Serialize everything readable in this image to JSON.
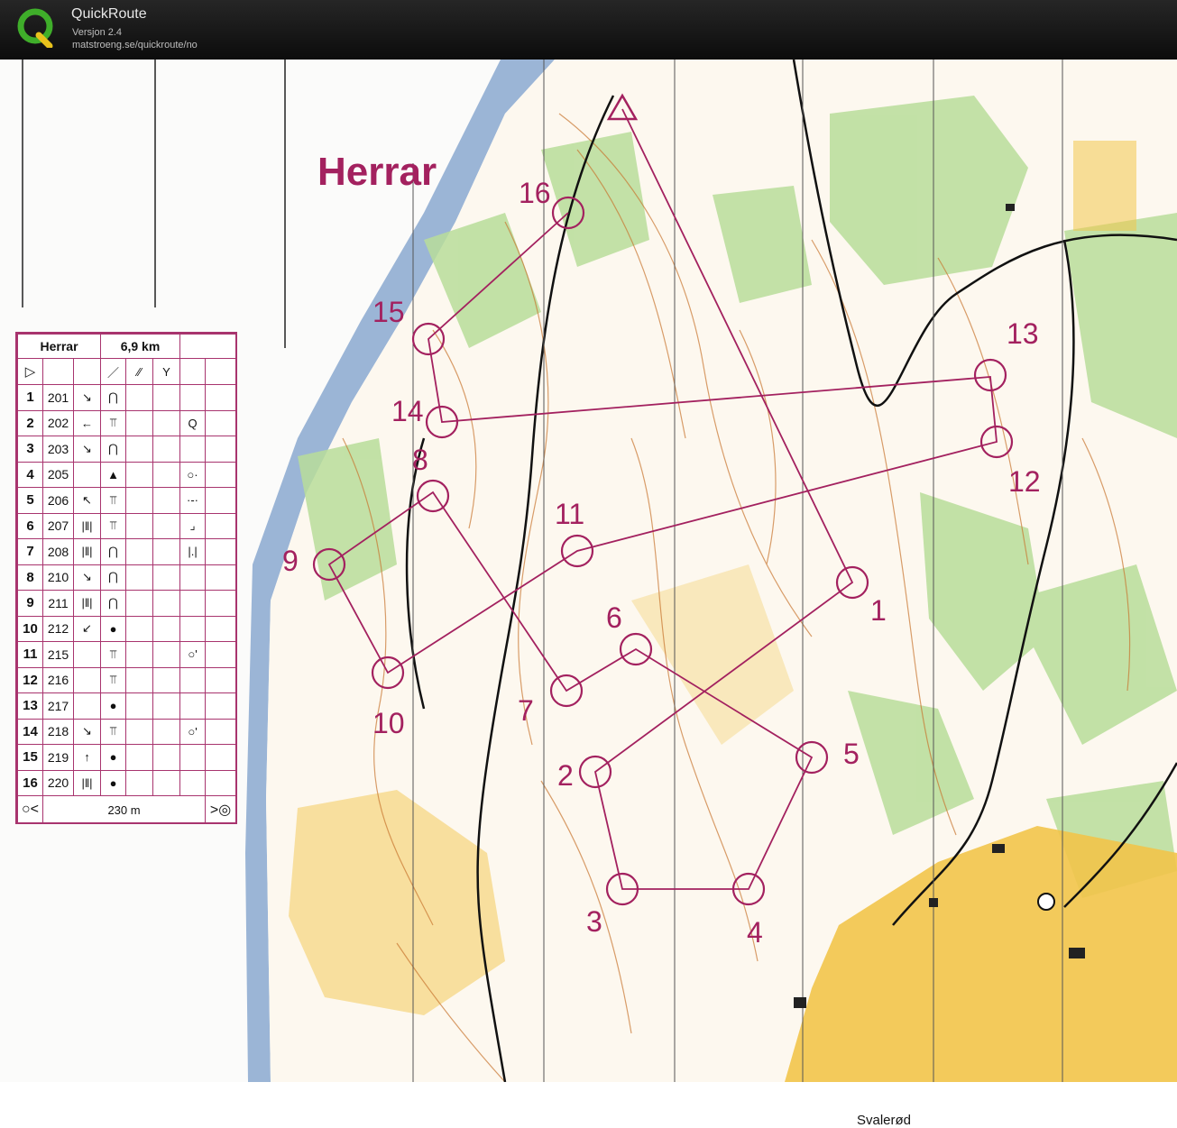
{
  "window": {
    "title": "QuickRoute",
    "version": "Versjon 2.4",
    "url": "matstroeng.se/quickroute/no"
  },
  "map": {
    "course_title": "Herrar",
    "place_label": "Svalerød",
    "colors": {
      "course": "#a3215f",
      "forest": "#b8dd9a",
      "open": "#f2c44a",
      "water": "#9bb5d6",
      "contour": "#c8752f"
    },
    "controls": [
      {
        "label": "1"
      },
      {
        "label": "2"
      },
      {
        "label": "3"
      },
      {
        "label": "4"
      },
      {
        "label": "5"
      },
      {
        "label": "6"
      },
      {
        "label": "7"
      },
      {
        "label": "8"
      },
      {
        "label": "9"
      },
      {
        "label": "10"
      },
      {
        "label": "11"
      },
      {
        "label": "12"
      },
      {
        "label": "13"
      },
      {
        "label": "14"
      },
      {
        "label": "15"
      },
      {
        "label": "16"
      }
    ]
  },
  "control_descriptions": {
    "class_name": "Herrar",
    "length": "6,9 km",
    "finish_distance": "230 m",
    "rows": [
      {
        "num": "1",
        "code": "201",
        "dir": "↘",
        "feature": "knoll",
        "extra": ""
      },
      {
        "num": "2",
        "code": "202",
        "dir": "←",
        "feature": "cliff",
        "extra": "search"
      },
      {
        "num": "3",
        "code": "203",
        "dir": "↘",
        "feature": "knoll",
        "extra": ""
      },
      {
        "num": "4",
        "code": "205",
        "dir": "",
        "feature": "triangle",
        "extra": "circle-dot"
      },
      {
        "num": "5",
        "code": "206",
        "dir": "↖",
        "feature": "cliff",
        "extra": "dots"
      },
      {
        "num": "6",
        "code": "207",
        "dir": "|‖|",
        "feature": "cliff",
        "extra": "corner"
      },
      {
        "num": "7",
        "code": "208",
        "dir": "|‖|",
        "feature": "knoll",
        "extra": "bar"
      },
      {
        "num": "8",
        "code": "210",
        "dir": "↘",
        "feature": "knoll",
        "extra": ""
      },
      {
        "num": "9",
        "code": "211",
        "dir": "|‖|",
        "feature": "knoll",
        "extra": ""
      },
      {
        "num": "10",
        "code": "212",
        "dir": "↙",
        "feature": "dot",
        "extra": ""
      },
      {
        "num": "11",
        "code": "215",
        "dir": "",
        "feature": "cliff",
        "extra": "circle-mark"
      },
      {
        "num": "12",
        "code": "216",
        "dir": "",
        "feature": "cliff",
        "extra": ""
      },
      {
        "num": "13",
        "code": "217",
        "dir": "",
        "feature": "dot",
        "extra": ""
      },
      {
        "num": "14",
        "code": "218",
        "dir": "↘",
        "feature": "cliff",
        "extra": "circle-mark"
      },
      {
        "num": "15",
        "code": "219",
        "dir": "↑",
        "feature": "dot",
        "extra": ""
      },
      {
        "num": "16",
        "code": "220",
        "dir": "|‖|",
        "feature": "dot",
        "extra": ""
      }
    ]
  }
}
